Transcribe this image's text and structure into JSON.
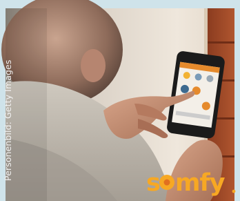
{
  "caption": {
    "credit": "Personenbild: Getty Images"
  },
  "brand": {
    "name": "somfy",
    "color": "#f7a823"
  },
  "colors": {
    "sky": "#cfe3ea",
    "wall": "#e6ddd2",
    "shelf": "#a14a2a",
    "sweater": "#b9b3aa",
    "skin": "#c79276"
  },
  "phone": {
    "icon_names": [
      "sun-icon",
      "blinds-icon",
      "window-icon",
      "house-icon",
      "lamp-icon",
      "heat-icon"
    ]
  }
}
